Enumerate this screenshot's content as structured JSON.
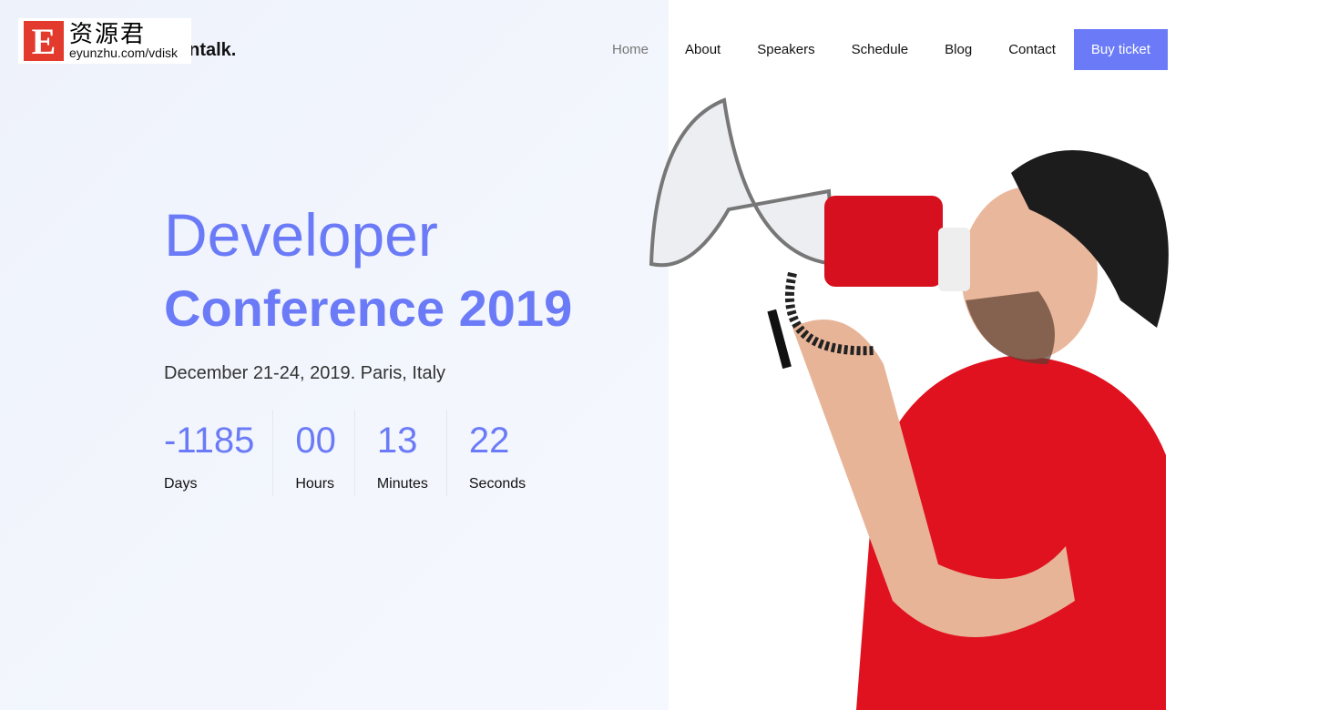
{
  "brand": {
    "name": "entalk.",
    "watermark_letter": "E",
    "watermark_cn": "资源君",
    "watermark_url": "eyunzhu.com/vdisk"
  },
  "nav": {
    "items": [
      "Home",
      "About",
      "Speakers",
      "Schedule",
      "Blog",
      "Contact"
    ],
    "active": "Home",
    "cta": "Buy ticket",
    "accent": "#6b7bf7"
  },
  "hero": {
    "title": "Developer",
    "subtitle": "Conference 2019",
    "date": "December 21-24, 2019. Paris, Italy",
    "countdown": [
      {
        "value": "-1185",
        "label": "Days"
      },
      {
        "value": "00",
        "label": "Hours"
      },
      {
        "value": "13",
        "label": "Minutes"
      },
      {
        "value": "22",
        "label": "Seconds"
      }
    ]
  }
}
